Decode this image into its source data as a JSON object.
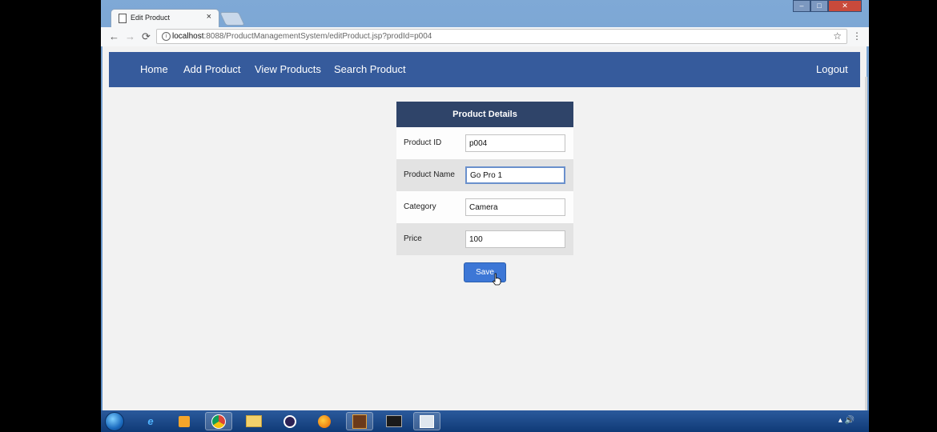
{
  "browser": {
    "tab_title": "Edit Product",
    "tab_close": "×",
    "url_host": "localhost",
    "url_rest": ":8088/ProductManagementSystem/editProduct.jsp?prodId=p004"
  },
  "navbar": {
    "items": [
      {
        "label": "Home"
      },
      {
        "label": "Add Product"
      },
      {
        "label": "View Products"
      },
      {
        "label": "Search Product"
      }
    ],
    "logout": "Logout"
  },
  "form": {
    "title": "Product Details",
    "fields": [
      {
        "label": "Product ID",
        "value": "p004"
      },
      {
        "label": "Product Name",
        "value": "Go Pro 1"
      },
      {
        "label": "Category",
        "value": "Camera"
      },
      {
        "label": "Price",
        "value": "100"
      }
    ],
    "save_label": "Save"
  },
  "icons": {
    "taskbar": [
      "ie-icon",
      "media-player-icon",
      "chrome-icon",
      "folder-icon",
      "eclipse-icon",
      "firefox-icon",
      "tomcat-icon",
      "cmd-icon",
      "app-icon"
    ]
  },
  "colors": {
    "navbar": "#365b9c",
    "panel_header": "#2f4469",
    "save_button": "#3d77d6",
    "page_bg": "#f2f2f2"
  }
}
